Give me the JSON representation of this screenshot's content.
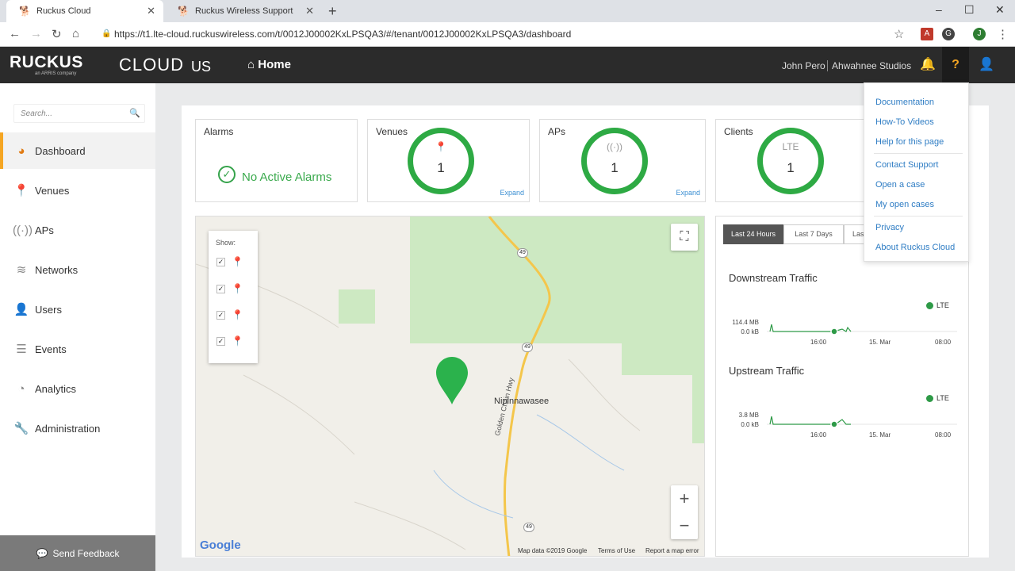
{
  "browser": {
    "tabs": [
      {
        "title": "Ruckus Cloud",
        "active": true
      },
      {
        "title": "Ruckus Wireless Support",
        "active": false
      }
    ],
    "url": "https://t1.lte-cloud.ruckuswireless.com/t/0012J00002KxLPSQA3/#/tenant/0012J00002KxLPSQA3/dashboard",
    "profile_initial": "J"
  },
  "header": {
    "logo": "RUCKUS",
    "logo_sub": "an ARRIS company",
    "product": "CLOUD",
    "region": "US",
    "home_label": "Home",
    "user_name": "John Pero",
    "tenant": "Ahwahnee Studios"
  },
  "sidebar": {
    "search_placeholder": "Search...",
    "items": [
      {
        "label": "Dashboard",
        "icon": "dashboard-icon",
        "active": true
      },
      {
        "label": "Venues",
        "icon": "venue-pin-icon"
      },
      {
        "label": "APs",
        "icon": "ap-icon"
      },
      {
        "label": "Networks",
        "icon": "wifi-icon"
      },
      {
        "label": "Users",
        "icon": "user-icon"
      },
      {
        "label": "Events",
        "icon": "events-icon"
      },
      {
        "label": "Analytics",
        "icon": "pie-chart-icon"
      },
      {
        "label": "Administration",
        "icon": "wrench-icon"
      }
    ],
    "feedback_label": "Send Feedback"
  },
  "cards": {
    "alarms": {
      "title": "Alarms",
      "status": "No Active Alarms"
    },
    "venues": {
      "title": "Venues",
      "value": "1",
      "expand": "Expand"
    },
    "aps": {
      "title": "APs",
      "value": "1",
      "expand": "Expand"
    },
    "clients": {
      "title": "Clients",
      "type": "LTE",
      "value": "1"
    }
  },
  "map": {
    "legend_title": "Show:",
    "legend_pins": [
      {
        "color": "#e53935",
        "checked": true
      },
      {
        "color": "#f39c23",
        "checked": true
      },
      {
        "color": "#666666",
        "checked": true
      },
      {
        "color": "#2eaa44",
        "checked": true
      }
    ],
    "place_label": "Nipinnawasee",
    "road_label": "Golden Chain Hwy",
    "route_number": "49",
    "google": "Google",
    "footer": [
      "Map data ©2019 Google",
      "Terms of Use",
      "Report a map error"
    ]
  },
  "traffic": {
    "tabs": [
      "Last 24 Hours",
      "Last 7 Days",
      "Las"
    ],
    "downstream": {
      "title": "Downstream Traffic",
      "legend": "LTE",
      "y_max": "114.4 MB",
      "y_min": "0.0 kB"
    },
    "upstream": {
      "title": "Upstream Traffic",
      "legend": "LTE",
      "y_max": "3.8 MB",
      "y_min": "0.0 kB"
    },
    "x_ticks": [
      "16:00",
      "15. Mar",
      "08:00"
    ]
  },
  "help_menu": {
    "group1": [
      "Documentation",
      "How-To Videos",
      "Help for this page"
    ],
    "group2": [
      "Contact Support",
      "Open a case",
      "My open cases"
    ],
    "group3": [
      "Privacy",
      "About Ruckus Cloud"
    ]
  },
  "colors": {
    "accent": "#f5a623",
    "ok_green": "#2eaa44",
    "link": "#2f7dc4",
    "header_bg": "#2b2b2b"
  }
}
